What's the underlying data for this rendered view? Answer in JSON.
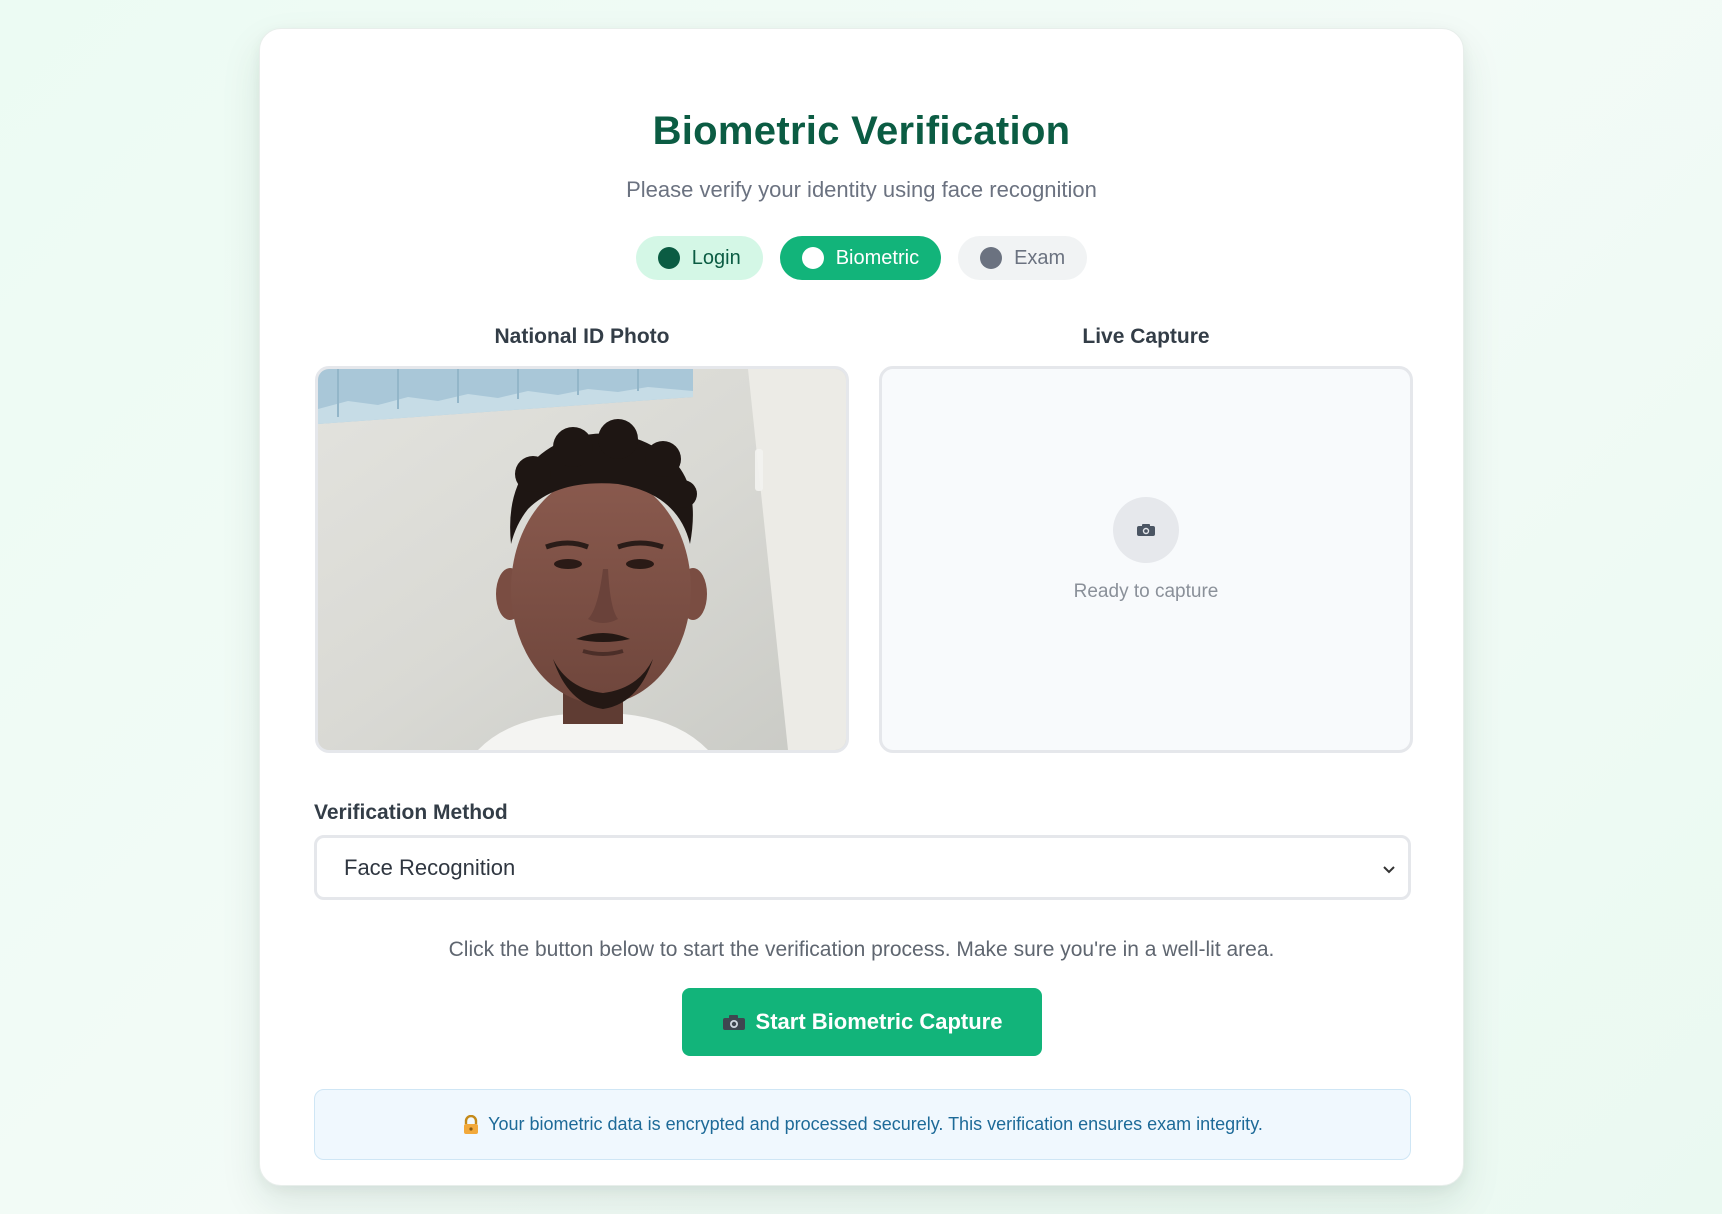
{
  "header": {
    "title": "Biometric Verification",
    "subtitle": "Please verify your identity using face recognition"
  },
  "steps": [
    {
      "label": "Login",
      "state": "completed"
    },
    {
      "label": "Biometric",
      "state": "active"
    },
    {
      "label": "Exam",
      "state": "pending"
    }
  ],
  "id_photo": {
    "label": "National ID Photo"
  },
  "live_capture": {
    "label": "Live Capture",
    "status": "Ready to capture",
    "icon": "camera-icon"
  },
  "method": {
    "label": "Verification Method",
    "selected": "Face Recognition"
  },
  "instructions": "Click the button below to start the verification process. Make sure you're in a well-lit area.",
  "start_button": {
    "label": "Start Biometric Capture",
    "icon": "camera-icon"
  },
  "security_note": {
    "text": "Your biometric data is encrypted and processed securely. This verification ensures exam integrity.",
    "icon": "lock-icon"
  },
  "colors": {
    "brand_dark": "#0b5c43",
    "accent": "#12b47a",
    "info_text": "#1d6a98"
  }
}
